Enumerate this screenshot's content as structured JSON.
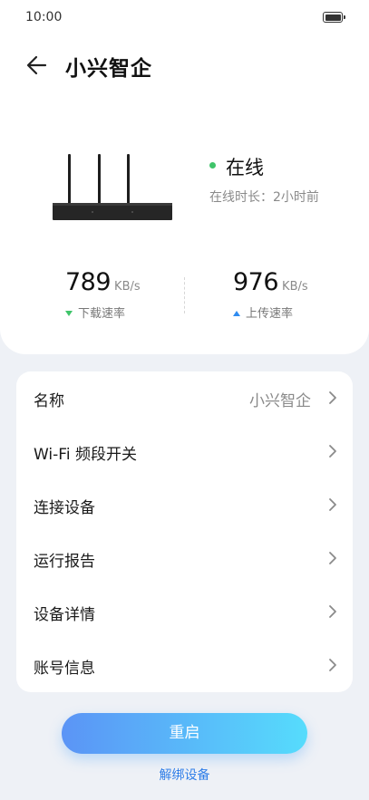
{
  "status_bar": {
    "time": "10:00",
    "battery_icon": "battery-full-icon"
  },
  "header": {
    "back_icon": "arrow-left-icon",
    "title": "小兴智企"
  },
  "device": {
    "image_icon": "router-icon",
    "status": "在线",
    "status_color": "#3fc46a",
    "online_duration": "在线时长：2小时前"
  },
  "speeds": {
    "download": {
      "value": "789",
      "unit": "KB/s",
      "label": "下载速率",
      "color": "#3fc46a"
    },
    "upload": {
      "value": "976",
      "unit": "KB/s",
      "label": "上传速率",
      "color": "#2f8cf0"
    }
  },
  "menu": {
    "items": [
      {
        "label": "名称",
        "value": "小兴智企"
      },
      {
        "label": "Wi-Fi 频段开关"
      },
      {
        "label": "连接设备"
      },
      {
        "label": "运行报告"
      },
      {
        "label": "设备详情"
      },
      {
        "label": "账号信息"
      }
    ]
  },
  "actions": {
    "restart_label": "重启",
    "unbind_label": "解绑设备",
    "accent_gradient": [
      "#5b94f6",
      "#56dcfc"
    ],
    "link_color": "#2f7ee8"
  }
}
